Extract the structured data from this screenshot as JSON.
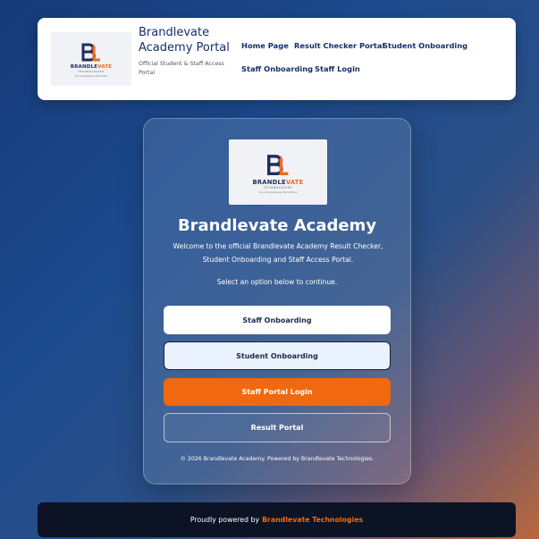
{
  "header": {
    "logo": {
      "word_main": "BRANDLE",
      "word_accent": "VATE",
      "sub": "TECHNOLOGIES",
      "tagline": "Your Comprehensive Tech Partner"
    },
    "title": "Brandlevate Academy Portal",
    "subtitle": "Official Student & Staff Access Portal",
    "nav": [
      "Home Page",
      "Result Checker Portal",
      "Student Onboarding",
      "Staff Onboarding",
      "Staff Login"
    ]
  },
  "card": {
    "title": "Brandlevate Academy",
    "intro": "Welcome to the official Brandlevate Academy Result Checker, Student Onboarding and Staff Access Portal.",
    "hint": "Select an option below to continue.",
    "buttons": {
      "staff_onboarding": "Staff Onboarding",
      "student_onboarding": "Student Onboarding",
      "staff_login": "Staff Portal Login",
      "result_portal": "Result Portal"
    },
    "copyright": "© 2026 Brandlevate Academy. Powered by Brandlevate Technologies."
  },
  "footer": {
    "prefix": "Proudly powered by",
    "brand": "Brandlevate Technologies"
  },
  "colors": {
    "navy": "#15306a",
    "accent_orange": "#f0690f",
    "footer_bg": "#0b1325"
  }
}
